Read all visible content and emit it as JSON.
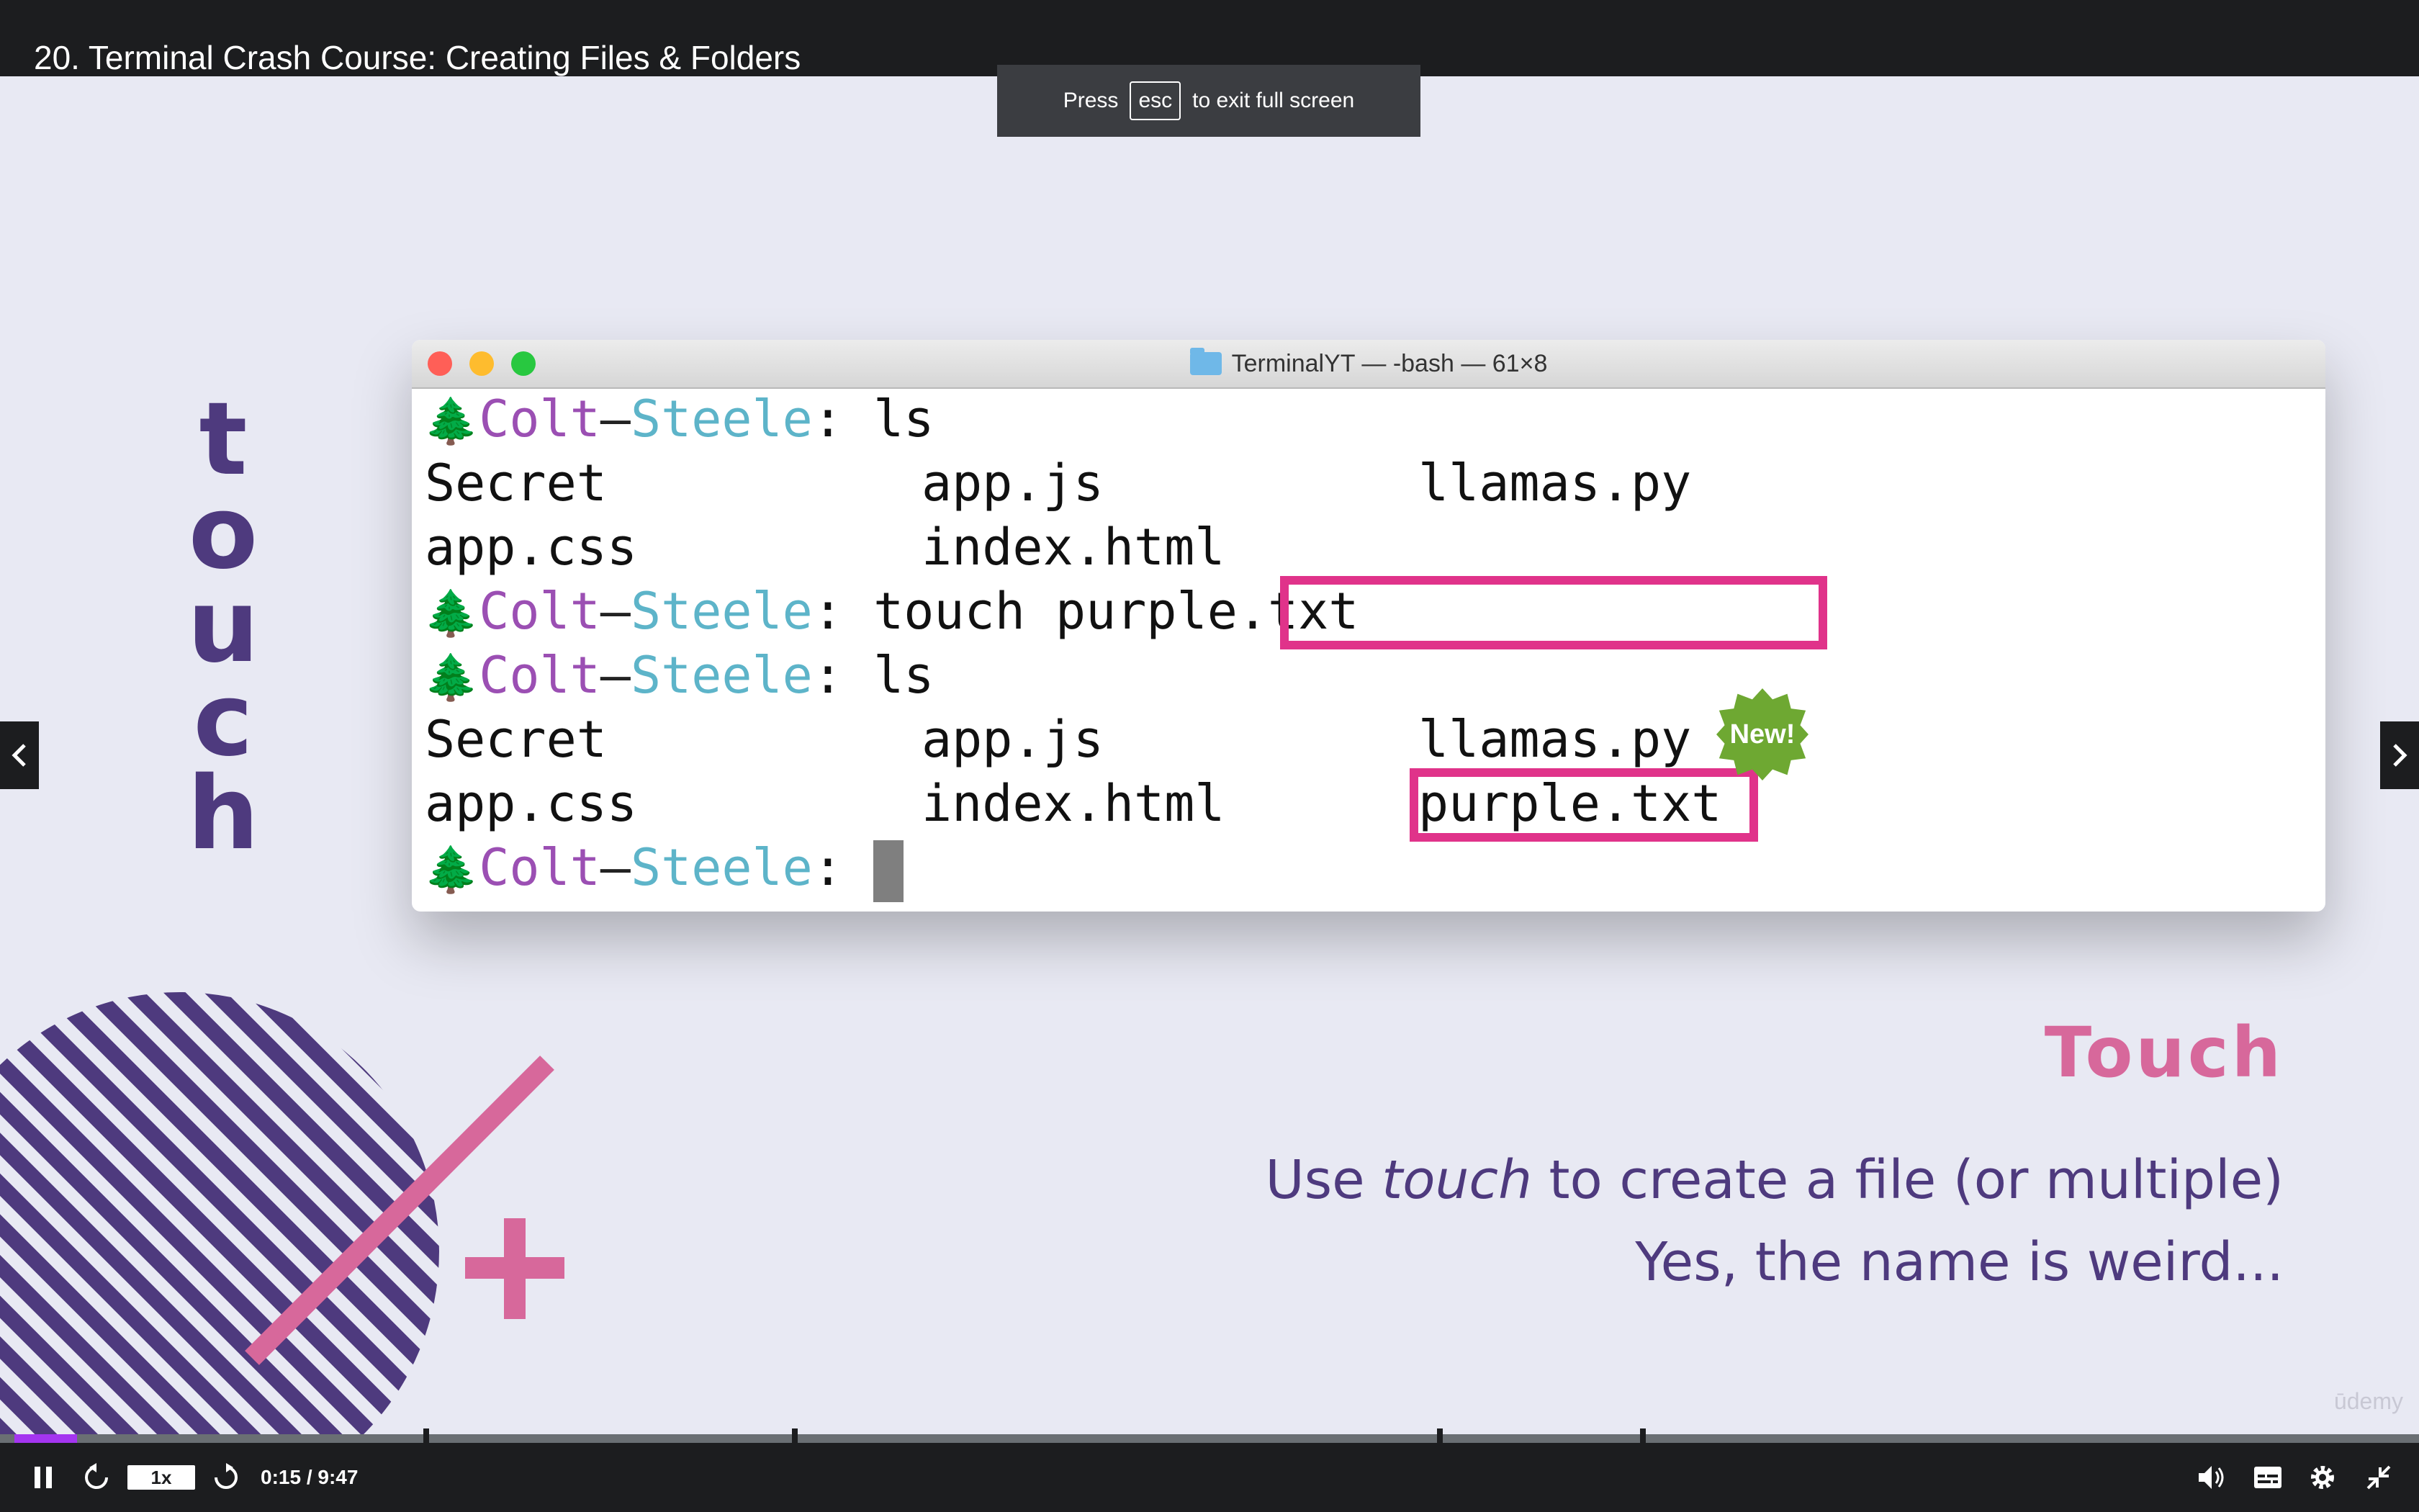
{
  "header": {
    "lecture_title": "20. Terminal Crash Course: Creating Files & Folders"
  },
  "fullscreen_toast": {
    "prefix": "Press",
    "key": "esc",
    "suffix": "to exit full screen"
  },
  "slide": {
    "vertical_word": "touch",
    "heading": "Touch",
    "description_pre": "Use ",
    "description_em": "touch",
    "description_post": " to create a file (or multiple)",
    "description_line2": "Yes, the name is weird...",
    "watermark": "ūdemy",
    "colors": {
      "purple": "#4e3a7e",
      "pink": "#d7689b",
      "highlight": "#e0338a",
      "badge": "#6ea832"
    }
  },
  "terminal": {
    "window_title": "TerminalYT — -bash — 61×8",
    "prompt_tree": "🌲",
    "prompt_colt": "Colt",
    "prompt_dash": "–",
    "prompt_steele": "Steele",
    "prompt_colon": ":",
    "cmd1": "ls",
    "cmd2": "touch purple.txt",
    "cmd3": "ls",
    "listing1": [
      [
        "Secret",
        "app.js",
        "llamas.py"
      ],
      [
        "app.css",
        "index.html",
        ""
      ]
    ],
    "listing2": [
      [
        "Secret",
        "app.js",
        "llamas.py"
      ],
      [
        "app.css",
        "index.html",
        "purple.txt"
      ]
    ],
    "new_badge": "New!"
  },
  "player": {
    "speed": "1x",
    "time": "0:15 / 9:47",
    "progress_fraction": 0.026,
    "icons": [
      "pause-icon",
      "rewind-5-icon",
      "forward-5-icon",
      "volume-icon",
      "captions-icon",
      "settings-gear-icon",
      "exit-fullscreen-icon"
    ]
  }
}
